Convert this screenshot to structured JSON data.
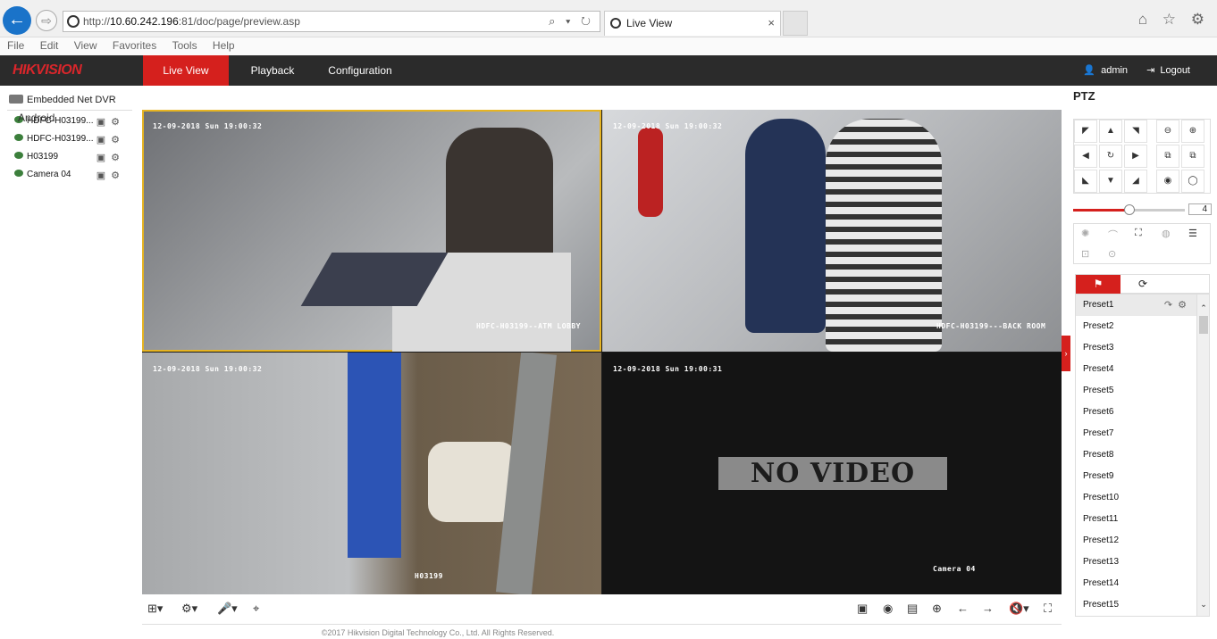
{
  "browser": {
    "url_prefix": "http://",
    "url_host": "10.60.242.196",
    "url_rest": ":81/doc/page/preview.asp",
    "url_tools": "⌕ ▾ ↻",
    "tab_title": "Live View",
    "tab_close": "×",
    "chrome_icons": "⌂ ☆ ⚙",
    "back_glyph": "←",
    "forward_glyph": "⇨"
  },
  "menubar": [
    "File",
    "Edit",
    "View",
    "Favorites",
    "Tools",
    "Help"
  ],
  "app": {
    "logo": "HIKVISION",
    "nav": {
      "live_view": "Live View",
      "playback": "Playback",
      "configuration": "Configuration"
    },
    "user": "admin",
    "logout": "Logout"
  },
  "tree": {
    "root": "Embedded Net DVR",
    "overlay_text": "Android",
    "cameras": [
      {
        "label": "HDFC-H03199..."
      },
      {
        "label": "HDFC-H03199..."
      },
      {
        "label": "H03199"
      },
      {
        "label": "Camera 04"
      }
    ]
  },
  "video": {
    "panes": [
      {
        "timestamp": "12-09-2018 Sun 19:00:32",
        "name": "HDFC-H03199--ATM LOBBY"
      },
      {
        "timestamp": "12-09-2018 Sun 19:00:32",
        "name": "HDFC-H03199---BACK ROOM"
      },
      {
        "timestamp": "12-09-2018 Sun 19:00:32",
        "name": "H03199"
      },
      {
        "timestamp": "12-09-2018 Sun 19:00:31",
        "name": "Camera 04",
        "no_video": "NO VIDEO"
      }
    ]
  },
  "ptz": {
    "title": "PTZ",
    "speed": 4,
    "speed_fraction": 0.5,
    "presets": [
      "Preset1",
      "Preset2",
      "Preset3",
      "Preset4",
      "Preset5",
      "Preset6",
      "Preset7",
      "Preset8",
      "Preset9",
      "Preset10",
      "Preset11",
      "Preset12",
      "Preset13",
      "Preset14",
      "Preset15"
    ]
  },
  "footer": "©2017 Hikvision Digital Technology Co., Ltd. All Rights Reserved.",
  "colors": {
    "accent": "#d5201d",
    "header_bg": "#2b2b2b",
    "selected_pane": "#e6b422"
  }
}
